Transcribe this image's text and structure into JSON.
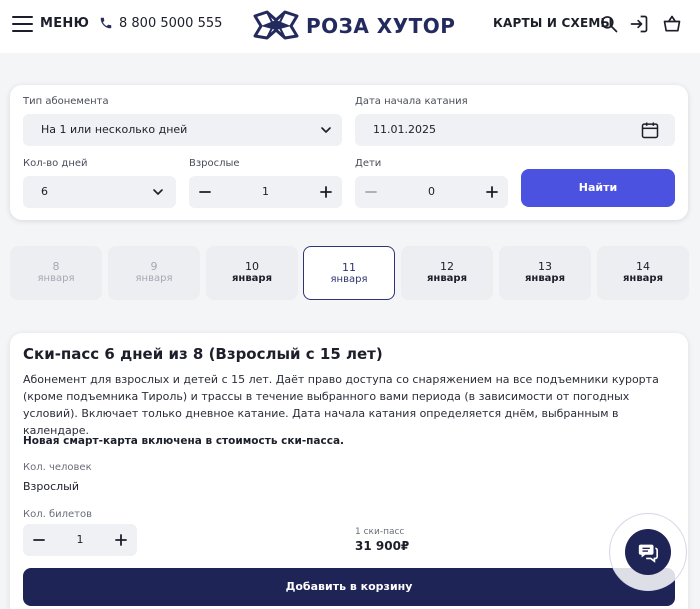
{
  "header": {
    "menu_label": "МЕНЮ",
    "phone": "8 800 5000 555",
    "logo_text": "РОЗА ХУТОР",
    "maps_label": "КАРТЫ И СХЕМЫ"
  },
  "form": {
    "pass_type_label": "Тип абонемента",
    "pass_type_value": "На 1 или несколько дней",
    "start_date_label": "Дата начала катания",
    "start_date_value": "11.01.2025",
    "days_label": "Кол-во дней",
    "days_value": "6",
    "adults_label": "Взрослые",
    "adults_value": "1",
    "children_label": "Дети",
    "children_value": "0",
    "find_button": "Найти"
  },
  "dates": [
    {
      "day": "8",
      "month": "января",
      "state": "disabled"
    },
    {
      "day": "9",
      "month": "января",
      "state": "disabled"
    },
    {
      "day": "10",
      "month": "января",
      "state": "normal"
    },
    {
      "day": "11",
      "month": "января",
      "state": "selected"
    },
    {
      "day": "12",
      "month": "января",
      "state": "normal"
    },
    {
      "day": "13",
      "month": "января",
      "state": "normal"
    },
    {
      "day": "14",
      "month": "января",
      "state": "normal"
    }
  ],
  "product": {
    "title": "Ски-пасс 6 дней из 8 (Взрослый с 15 лет)",
    "description": "Абонемент для взрослых и детей с 15 лет. Даёт право доступа со снаряжением на все подъемники курорта (кроме подъемника Тироль) и трассы в течение выбранного вами периода (в зависимости от погодных условий). Включает только дневное катание. Дата начала катания определяется днём, выбранным в календаре.",
    "note": "Новая смарт-карта включена в стоимость ски-пасса.",
    "persons_label": "Кол. человек",
    "persons_value": "Взрослый",
    "tickets_label": "Кол. билетов",
    "tickets_value": "1",
    "price_label": "1 ски-пасс",
    "price": "31 900₽",
    "cart_button": "Добавить в корзину"
  },
  "icons": {
    "menu": "hamburger-icon",
    "phone": "phone-icon",
    "search": "search-icon",
    "login": "login-icon",
    "cart": "basket-icon",
    "calendar": "calendar-icon",
    "chat": "chat-icon"
  },
  "colors": {
    "accent": "#4c52e0",
    "brand_dark": "#1f2456",
    "logo": "#232a5e"
  }
}
